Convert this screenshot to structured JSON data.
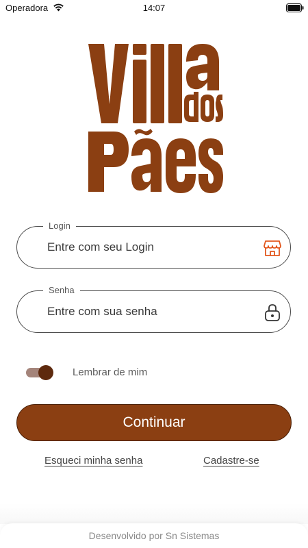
{
  "status_bar": {
    "carrier": "Operadora",
    "time": "14:07",
    "wifi_icon": "wifi-icon",
    "battery_icon": "battery-icon"
  },
  "logo": {
    "text": "Villa dos Pães",
    "color": "#8b3f12"
  },
  "login_field": {
    "label": "Login",
    "placeholder": "Entre com seu Login",
    "value": "",
    "icon": "storefront-icon",
    "icon_color": "#e2571e"
  },
  "password_field": {
    "label": "Senha",
    "placeholder": "Entre com sua senha",
    "value": "",
    "icon": "lock-icon"
  },
  "remember": {
    "label": "Lembrar de mim",
    "checked": true
  },
  "continue_button": {
    "label": "Continuar",
    "color": "#8b3f12"
  },
  "links": {
    "forgot_password": "Esqueci minha senha",
    "sign_up": "Cadastre-se"
  },
  "footer": {
    "text": "Desenvolvido por Sn Sistemas"
  }
}
